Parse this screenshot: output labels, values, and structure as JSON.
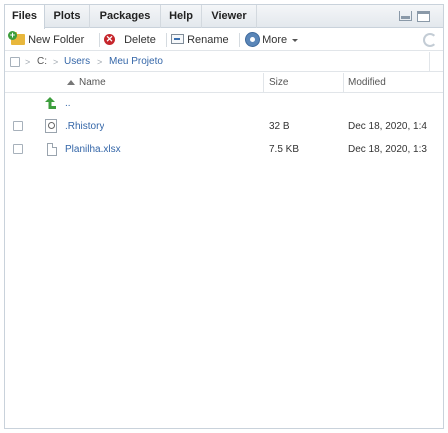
{
  "tabs": [
    {
      "label": "Files",
      "active": true
    },
    {
      "label": "Plots",
      "active": false
    },
    {
      "label": "Packages",
      "active": false
    },
    {
      "label": "Help",
      "active": false
    },
    {
      "label": "Viewer",
      "active": false
    }
  ],
  "toolbar": {
    "new_folder": "New Folder",
    "delete": "Delete",
    "rename": "Rename",
    "more": "More"
  },
  "breadcrumb": [
    "C:",
    "Users",
    "Meu Projeto"
  ],
  "columns": {
    "name": "Name",
    "size": "Size",
    "modified": "Modified"
  },
  "up_label": "..",
  "files": [
    {
      "name": ".Rhistory",
      "size": "32 B",
      "modified": "Dec 18, 2020, 1:4",
      "icon": "history-file-icon"
    },
    {
      "name": "Planilha.xlsx",
      "size": "7.5 KB",
      "modified": "Dec 18, 2020, 1:3",
      "icon": "file-icon"
    }
  ],
  "colors": {
    "accent": "#3466a8",
    "up_arrow": "#3d9e3d"
  }
}
